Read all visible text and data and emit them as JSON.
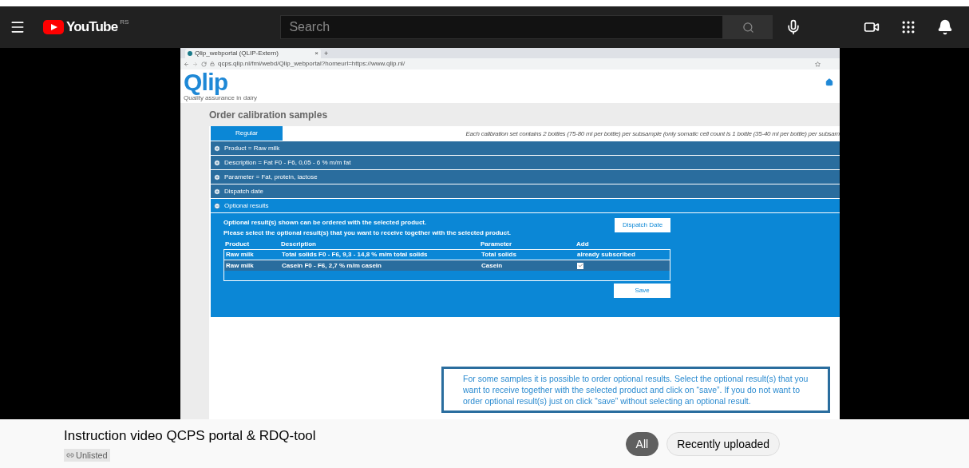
{
  "header": {
    "logo": "YouTube",
    "country": "RS",
    "search": {
      "placeholder": "Search"
    }
  },
  "video": {
    "browser": {
      "tab_title": "Qlip_webportal (QLIP-Extern)",
      "tab_close": "×",
      "new_tab": "+",
      "url": "qcps.qlip.nl/fmi/webd/Qlip_webportal?homeurl=https://www.qlip.nl/"
    },
    "logo": "Qlip",
    "tagline": "Quality assurance in dairy",
    "page_title": "Order calibration samples",
    "tabs": [
      {
        "label": "Regular",
        "selected": true
      }
    ],
    "note": "Each calibration set contains 2 bottles (75-80 ml per bottle) per subsample (only somatic cell count is 1 bottle  (35-40 ml per bottle) per subsam",
    "sections": [
      {
        "label": "Product = Raw milk",
        "expanded": false
      },
      {
        "label": "Description = Fat F0 - F6, 0,05 - 6 % m/m fat",
        "expanded": false
      },
      {
        "label": "Parameter = Fat, protein, lactose",
        "expanded": false
      },
      {
        "label": "Dispatch date",
        "expanded": false
      },
      {
        "label": "Optional results",
        "expanded": true
      }
    ],
    "optional": {
      "lines": [
        "Optional result(s) shown can be ordered with the selected product.",
        "Please select the optional result(s) that you want to receive together with the selected product."
      ],
      "dispatch_button": "Dispatch Date",
      "save_button": "Save",
      "columns": [
        "Product",
        "Description",
        "Parameter",
        "Add"
      ],
      "rows": [
        {
          "product": "Raw milk",
          "description": "Total solids F0 - F6, 9,3 - 14,8 % m/m total solids",
          "parameter": "Total solids",
          "kind": "text",
          "add": "already subscribed",
          "selected": false
        },
        {
          "product": "Raw milk",
          "description": "Casein F0 - F6, 2,7 % m/m casein",
          "parameter": "Casein",
          "kind": "checkbox",
          "checked": true,
          "selected": true
        }
      ]
    },
    "callout": "For some samples it is possible to order optional results. Select the optional result(s) that you want to receive together with the selected product and click on “save”. If you do not want to order optional result(s) just on click “save” without selecting an optional result."
  },
  "details": {
    "title": "Instruction video QCPS portal & RDQ-tool",
    "visibility": "Unlisted"
  },
  "chips": [
    {
      "label": "All",
      "selected": true
    },
    {
      "label": "Recently uploaded",
      "selected": false
    }
  ]
}
